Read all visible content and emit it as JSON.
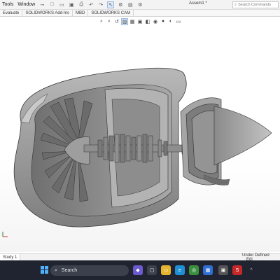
{
  "titlebar": {
    "menu": [
      "Tools",
      "Window"
    ],
    "doc_title": "Assem1 *",
    "search_placeholder": "Search Commands"
  },
  "command_tabs": [
    "Evaluate",
    "SOLIDWORKS Add-Ins",
    "MBD",
    "SOLIDWORKS CAM"
  ],
  "motion_tabs": [
    "Study 1"
  ],
  "status": {
    "state": "Under Defined",
    "edit": "Edi"
  },
  "taskbar": {
    "search_label": "Search"
  },
  "colors": {
    "model_grey": "#9a9a9a",
    "taskbar_bg": "#1f2430",
    "accent": "#4fb3ff"
  }
}
